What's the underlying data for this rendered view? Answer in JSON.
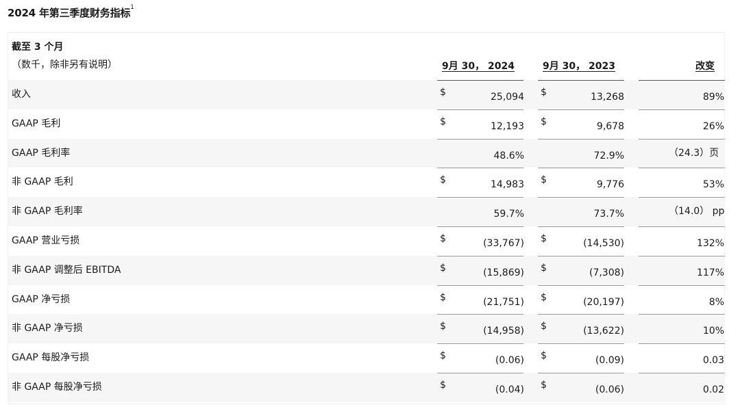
{
  "title": "2024 年第三季度财务指标",
  "title_footnote": "1",
  "header": {
    "line1": "截至 3 个月",
    "line2": "（数千，除非另有说明）",
    "col1": "9月 30， 2024",
    "col2": "9月 30， 2023",
    "col3": "改变"
  },
  "rows": [
    {
      "label": "收入",
      "c1": "25,094",
      "c2": "13,268",
      "chg": "89%",
      "dollar": "$"
    },
    {
      "label": "GAAP 毛利",
      "c1": "12,193",
      "c2": "9,678",
      "chg": "26%",
      "dollar": "$"
    },
    {
      "label": "GAAP 毛利率",
      "c1": "48.6%",
      "c2": "72.9%",
      "chg": "（24.3）页",
      "dollar": ""
    },
    {
      "label": "非 GAAP 毛利",
      "c1": "14,983",
      "c2": "9,776",
      "chg": "53%",
      "dollar": "$"
    },
    {
      "label": "非 GAAP 毛利率",
      "c1": "59.7%",
      "c2": "73.7%",
      "chg": "（14.0） pp",
      "dollar": ""
    },
    {
      "label": "GAAP 营业亏损",
      "c1": "(33,767)",
      "c2": "(14,530)",
      "chg": "132%",
      "dollar": "$"
    },
    {
      "label": "非 GAAP 调整后 EBITDA",
      "c1": "(15,869)",
      "c2": "(7,308)",
      "chg": "117%",
      "dollar": "$"
    },
    {
      "label": "GAAP 净亏损",
      "c1": "(21,751)",
      "c2": "(20,197)",
      "chg": "8%",
      "dollar": "$"
    },
    {
      "label": "非 GAAP 净亏损",
      "c1": "(14,958)",
      "c2": "(13,622)",
      "chg": "10%",
      "dollar": "$"
    },
    {
      "label": "GAAP 每股净亏损",
      "c1": "(0.06)",
      "c2": "(0.09)",
      "chg": "0.03",
      "dollar": "$"
    },
    {
      "label": "非 GAAP 每股净亏损",
      "c1": "(0.04)",
      "c2": "(0.06)",
      "chg": "0.02",
      "dollar": "$"
    }
  ]
}
